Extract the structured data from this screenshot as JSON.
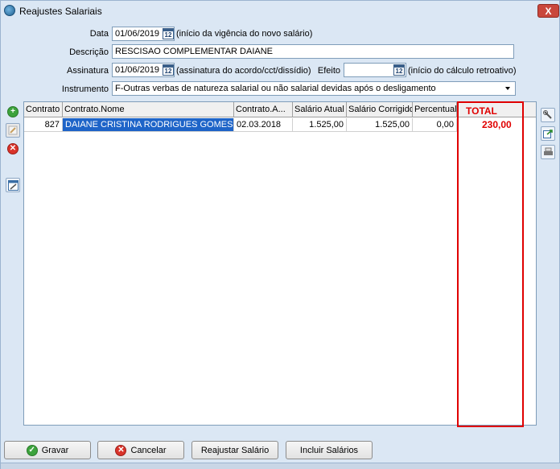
{
  "window": {
    "title": "Reajustes Salariais",
    "close_label": "X"
  },
  "form": {
    "data_label": "Data",
    "data_value": "01/06/2019",
    "data_hint": "(início da vigência do novo salário)",
    "descricao_label": "Descrição",
    "descricao_value": "RESCISAO COMPLEMENTAR DAIANE",
    "assinatura_label": "Assinatura",
    "assinatura_value": "01/06/2019",
    "assinatura_hint": "(assinatura do acordo/cct/dissídio)",
    "efeito_label": "Efeito",
    "efeito_value": "",
    "efeito_hint": "(início do cálculo retroativo)",
    "instrumento_label": "Instrumento",
    "instrumento_value": "F-Outras verbas de natureza salarial ou não salarial devidas após o desligamento",
    "calendar_icon_text": "12"
  },
  "grid": {
    "columns": [
      "Contrato",
      "Contrato.Nome",
      "Contrato.A...",
      "Salário Atual",
      "Salário Corrigido",
      "Percentual"
    ],
    "rows": [
      {
        "contrato": "827",
        "nome": "DAIANE CRISTINA RODRIGUES GOMES",
        "admissao": "02.03.2018",
        "salario_atual": "1.525,00",
        "salario_corrigido": "1.525,00",
        "percentual": "0,00"
      }
    ]
  },
  "annotation": {
    "label": "TOTAL",
    "value": "230,00",
    "color": "#e00000"
  },
  "buttons": {
    "gravar": "Gravar",
    "cancelar": "Cancelar",
    "reajustar": "Reajustar Salário",
    "incluir": "Incluir Salários"
  },
  "icons": {
    "left_toolbar": [
      "add-icon",
      "edit-icon",
      "delete-icon",
      "form-icon"
    ],
    "right_toolbar": [
      "tools-icon",
      "export-icon",
      "print-icon"
    ]
  },
  "colors": {
    "selection": "#1e64c8",
    "window_bg": "#dbe7f4"
  }
}
